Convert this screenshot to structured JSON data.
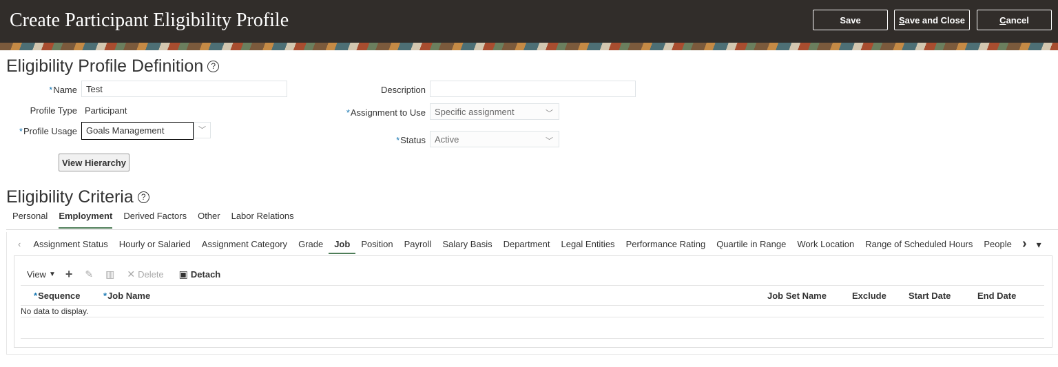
{
  "header": {
    "title": "Create Participant Eligibility Profile",
    "save_label": "Save",
    "save_close_prefix": "S",
    "save_close_rest": "ave and Close",
    "cancel_prefix": "C",
    "cancel_rest": "ancel"
  },
  "definition": {
    "title": "Eligibility Profile Definition",
    "help_icon": "question-circle-icon",
    "name_label": "Name",
    "name_value": "Test",
    "profile_type_label": "Profile Type",
    "profile_type_value": "Participant",
    "profile_usage_label": "Profile Usage",
    "profile_usage_value": "Goals Management",
    "description_label": "Description",
    "description_value": "",
    "assignment_label": "Assignment to Use",
    "assignment_value": "Specific assignment",
    "status_label": "Status",
    "status_value": "Active",
    "view_hierarchy_label": "View Hierarchy",
    "required_marker": "*"
  },
  "criteria": {
    "title": "Eligibility Criteria",
    "tabs": [
      "Personal",
      "Employment",
      "Derived Factors",
      "Other",
      "Labor Relations"
    ],
    "active_tab": "Employment",
    "subtabs": [
      "Assignment Status",
      "Hourly or Salaried",
      "Assignment Category",
      "Grade",
      "Job",
      "Position",
      "Payroll",
      "Salary Basis",
      "Department",
      "Legal Entities",
      "Performance Rating",
      "Quartile in Range",
      "Work Location",
      "Range of Scheduled Hours",
      "People"
    ],
    "active_subtab": "Job",
    "subtab_prev_icon": "‹",
    "subtab_next_icon": "›",
    "subtab_menu_icon": "▾"
  },
  "table": {
    "view_label": "View",
    "delete_label": "Delete",
    "detach_label": "Detach",
    "columns": {
      "sequence": "Sequence",
      "job_name": "Job Name",
      "job_set_name": "Job Set Name",
      "exclude": "Exclude",
      "start_date": "Start Date",
      "end_date": "End Date"
    },
    "empty_text": "No data to display."
  },
  "colors": {
    "header_bg": "#312d2a",
    "required": "#1c7ab4",
    "tab_underline": "#4e7d58"
  }
}
